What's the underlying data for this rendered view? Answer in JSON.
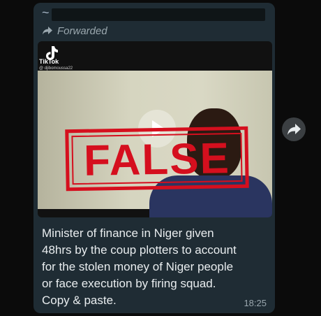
{
  "message": {
    "forwarded_label": "Forwarded",
    "caption_lines": [
      "Minister of finance in Niger given",
      "48hrs by the coup plotters to account",
      "for the stolen money of Niger people",
      "or face execution by firing squad.",
      "Copy & paste."
    ],
    "time": "18:25"
  },
  "video": {
    "watermark_label": "TikTok",
    "watermark_handle": "@ djibomoussa22",
    "stamp_text": "FALSE"
  },
  "colors": {
    "bubble": "#1f2c34",
    "stamp": "#d50f1e",
    "text": "#e9edef",
    "meta": "#9aa7ae"
  },
  "icons": {
    "forwarded": "forward-arrow-icon",
    "share": "forward-arrow-icon",
    "play": "play-icon",
    "tiktok": "tiktok-logo-icon"
  }
}
